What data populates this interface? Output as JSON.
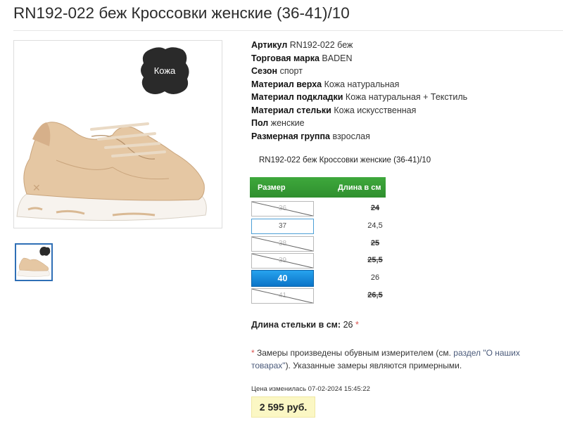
{
  "product": {
    "title": "RN192-022 беж Кроссовки женские (36-41)/10",
    "subtitle": "RN192-022 беж Кроссовки женские (36-41)/10"
  },
  "badge": {
    "text": "Кожа"
  },
  "specs": [
    {
      "key": "Артикул",
      "value": "RN192-022 беж"
    },
    {
      "key": "Торговая марка",
      "value": "BADEN"
    },
    {
      "key": "Сезон",
      "value": "спорт"
    },
    {
      "key": "Материал верха",
      "value": "Кожа натуральная"
    },
    {
      "key": "Материал подкладки",
      "value": "Кожа натуральная + Текстиль"
    },
    {
      "key": "Материал стельки",
      "value": "Кожа искусственная"
    },
    {
      "key": "Пол",
      "value": "женские"
    },
    {
      "key": "Размерная группа",
      "value": "взрослая"
    }
  ],
  "size_table": {
    "header_size": "Размер",
    "header_length": "Длина в см",
    "rows": [
      {
        "size": "36",
        "length": "24",
        "state": "unavailable"
      },
      {
        "size": "37",
        "length": "24,5",
        "state": "available"
      },
      {
        "size": "38",
        "length": "25",
        "state": "unavailable"
      },
      {
        "size": "39",
        "length": "25,5",
        "state": "unavailable"
      },
      {
        "size": "40",
        "length": "26",
        "state": "selected"
      },
      {
        "size": "41",
        "length": "26,5",
        "state": "unavailable"
      }
    ]
  },
  "insole": {
    "label": "Длина стельки в см:",
    "value": "26",
    "star": "*"
  },
  "note": {
    "star": "*",
    "text1": " Замеры произведены обувным измерителем (см. ",
    "link": "раздел \"О наших товарах\"",
    "text2": "). Указанные замеры являются примерными."
  },
  "price": {
    "changed": "Цена изменилась 07-02-2024 15:45:22",
    "value": "2 595 руб."
  },
  "colors": {
    "accent_green": "#3ea83c",
    "selected_blue": "#0b74c8",
    "price_bg": "#fbf7c4"
  }
}
